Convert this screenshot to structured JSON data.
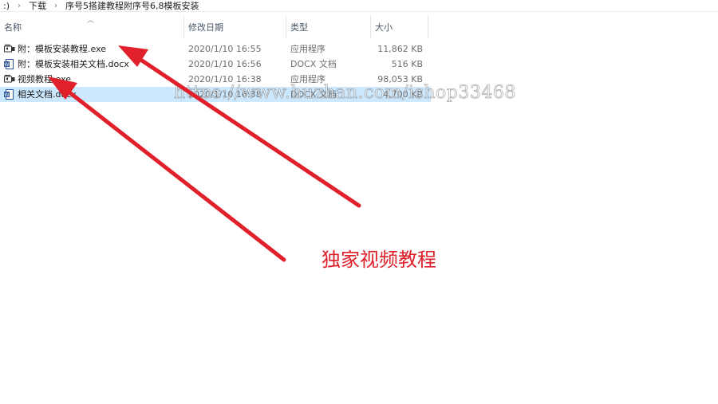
{
  "breadcrumb": [
    ":)",
    "下载",
    "序号5搭建教程附序号6,8模板安装"
  ],
  "columns": {
    "name": "名称",
    "date": "修改日期",
    "type": "类型",
    "size": "大小"
  },
  "files": [
    {
      "name": "附：模板安装教程.exe",
      "date": "2020/1/10 16:55",
      "type": "应用程序",
      "size": "11,862 KB",
      "icon": "exe-icon"
    },
    {
      "name": "附：模板安装相关文档.docx",
      "date": "2020/1/10 16:56",
      "type": "DOCX 文档",
      "size": "516 KB",
      "icon": "docx-icon"
    },
    {
      "name": "视频教程.exe",
      "date": "2020/1/10 16:38",
      "type": "应用程序",
      "size": "98,053 KB",
      "icon": "exe-icon"
    },
    {
      "name": "相关文档.docx",
      "date": "2020/1/10 16:38",
      "type": "DOCX 文档",
      "size": "4,700 KB",
      "icon": "docx-icon",
      "selected": true
    }
  ],
  "watermark": "https://www.huzhan.com/ishop33468",
  "annotation": "独家视频教程",
  "colors": {
    "arrow": "#e0202a",
    "selection": "#cce8ff",
    "header_text": "#4a5766"
  }
}
